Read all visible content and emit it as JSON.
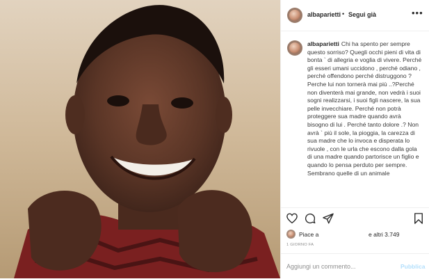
{
  "post": {
    "username": "albaparietti",
    "separator": "•",
    "follow_label": "Segui già",
    "more_label": "•••",
    "caption": "Chi ha spento per sempre questo sorriso? Quegli occhi pieni di vita di bonta ` di allegria e voglia di vivere. Perché gli esseri umani uccidono , perché odiano , perché offendono perché distruggono ? Perche lui non tornerà mai più ..?Perché non diventerà mai grande, non vedrà i suoi sogni realizzarsi, i suoi figli nascere, la sua pelle invecchiare. Perché non potrà proteggere sua madre quando avrà bisogno di lui . Perché tanto dolore .? Non avrà ` più il sole, la pioggia, la carezza di sua madre che lo invoca e disperata lo rivuole , con le urla che escono dalla gola di una madre quando partorisce un figlio e quando lo pensa perduto per sempre. Sembrano quelle di un animale",
    "likes_prefix": "Piace a",
    "likes_suffix": "e altri 3.749",
    "time": "1 GIORNO FA",
    "comment_placeholder": "Aggiungi un commento...",
    "publish_label": "Pubblica"
  },
  "icons": {
    "like": "heart-icon",
    "comment": "comment-icon",
    "share": "share-icon",
    "save": "bookmark-icon"
  },
  "colors": {
    "accent_disabled": "#b2dffc",
    "text": "#262626",
    "muted": "#8e8e8e"
  }
}
